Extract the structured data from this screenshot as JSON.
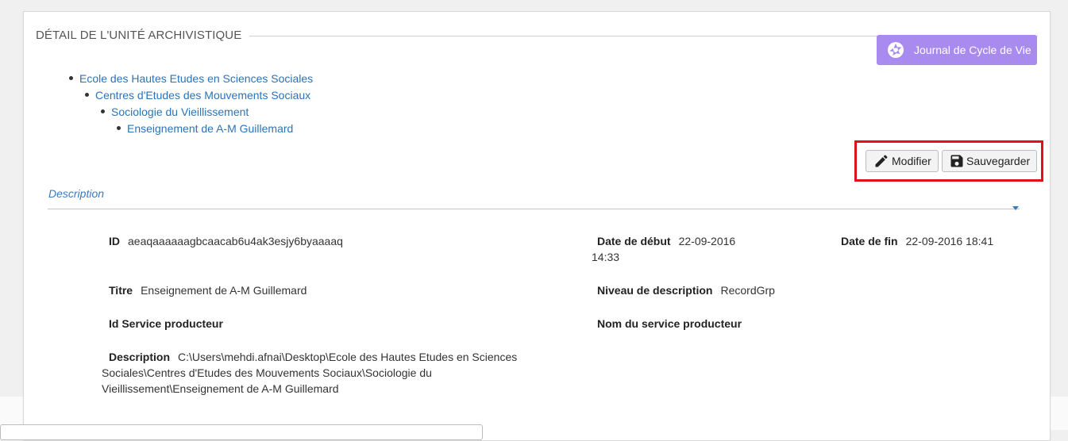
{
  "panel": {
    "title": "DÉTAIL DE L'UNITÉ ARCHIVISTIQUE",
    "lifecycle_button": "Journal de Cycle de Vie"
  },
  "tree": [
    "Ecole des Hautes Etudes en Sciences Sociales",
    "Centres d'Etudes des Mouvements Sociaux",
    "Sociologie du Vieillissement",
    "Enseignement de A-M Guillemard"
  ],
  "actions": {
    "modify_label": "Modifier",
    "save_label": "Sauvegarder"
  },
  "description_section": {
    "title": "Description",
    "fields": {
      "id": {
        "label": "ID",
        "value": "aeaqaaaaaagbcaacab6u4ak3esjy6byaaaaq"
      },
      "start_date": {
        "label": "Date de début",
        "value": "22-09-2016",
        "value_cont": "14:33"
      },
      "end_date": {
        "label": "Date de fin",
        "value": "22-09-2016 18:41"
      },
      "title": {
        "label": "Titre",
        "value": "Enseignement de A-M Guillemard"
      },
      "level": {
        "label": "Niveau de description",
        "value": "RecordGrp"
      },
      "producer_id": {
        "label": "Id Service producteur",
        "value": ""
      },
      "producer_name": {
        "label": "Nom du service producteur",
        "value": ""
      },
      "description": {
        "label": "Description",
        "line1": "C:\\Users\\mehdi.afnai\\Desktop\\Ecole des Hautes Etudes en Sciences",
        "line2": "Sociales\\Centres d'Etudes des Mouvements Sociaux\\Sociologie du",
        "line3": "Vieillissement\\Enseignement de A-M Guillemard"
      }
    }
  },
  "icons": {
    "lifecycle": "aperture-icon",
    "modify": "pencil-icon",
    "save": "floppy-disk-icon"
  },
  "colors": {
    "accent": "#a98bf0",
    "link": "#2a73b8",
    "highlight": "#e0101d"
  }
}
